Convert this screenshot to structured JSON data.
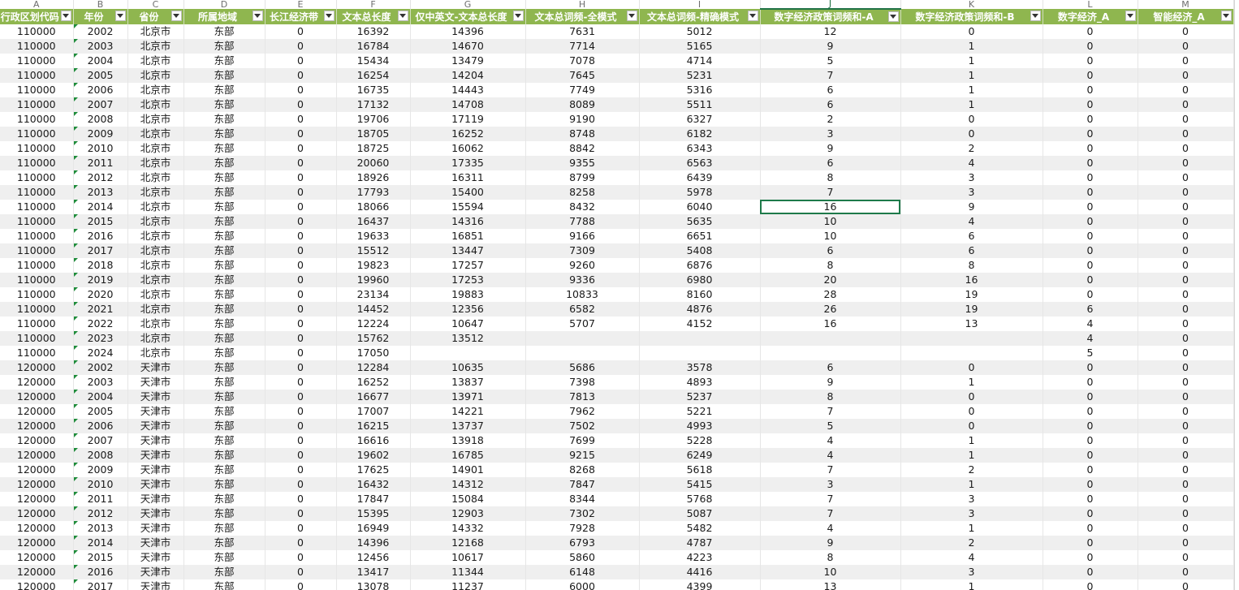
{
  "column_letters": [
    "A",
    "B",
    "C",
    "D",
    "E",
    "F",
    "G",
    "H",
    "I",
    "J",
    "K",
    "L",
    "M"
  ],
  "active_column": "J",
  "headers": [
    "行政区划代码",
    "年份",
    "省份",
    "所属地域",
    "长江经济带",
    "文本总长度",
    "仅中英文-文本总长度",
    "文本总词频-全模式",
    "文本总词频-精确模式",
    "数字经济政策词频和-A",
    "数字经济政策词频和-B",
    "数字经济_A",
    "智能经济_A"
  ],
  "rows": [
    [
      "110000",
      "2002",
      "北京市",
      "东部",
      "0",
      "16392",
      "14396",
      "7631",
      "5012",
      "12",
      "0",
      "0",
      "0"
    ],
    [
      "110000",
      "2003",
      "北京市",
      "东部",
      "0",
      "16784",
      "14670",
      "7714",
      "5165",
      "9",
      "1",
      "0",
      "0"
    ],
    [
      "110000",
      "2004",
      "北京市",
      "东部",
      "0",
      "15434",
      "13479",
      "7078",
      "4714",
      "5",
      "1",
      "0",
      "0"
    ],
    [
      "110000",
      "2005",
      "北京市",
      "东部",
      "0",
      "16254",
      "14204",
      "7645",
      "5231",
      "7",
      "1",
      "0",
      "0"
    ],
    [
      "110000",
      "2006",
      "北京市",
      "东部",
      "0",
      "16735",
      "14443",
      "7749",
      "5316",
      "6",
      "1",
      "0",
      "0"
    ],
    [
      "110000",
      "2007",
      "北京市",
      "东部",
      "0",
      "17132",
      "14708",
      "8089",
      "5511",
      "6",
      "1",
      "0",
      "0"
    ],
    [
      "110000",
      "2008",
      "北京市",
      "东部",
      "0",
      "19706",
      "17119",
      "9190",
      "6327",
      "2",
      "0",
      "0",
      "0"
    ],
    [
      "110000",
      "2009",
      "北京市",
      "东部",
      "0",
      "18705",
      "16252",
      "8748",
      "6182",
      "3",
      "0",
      "0",
      "0"
    ],
    [
      "110000",
      "2010",
      "北京市",
      "东部",
      "0",
      "18725",
      "16062",
      "8842",
      "6343",
      "9",
      "2",
      "0",
      "0"
    ],
    [
      "110000",
      "2011",
      "北京市",
      "东部",
      "0",
      "20060",
      "17335",
      "9355",
      "6563",
      "6",
      "4",
      "0",
      "0"
    ],
    [
      "110000",
      "2012",
      "北京市",
      "东部",
      "0",
      "18926",
      "16311",
      "8799",
      "6439",
      "8",
      "3",
      "0",
      "0"
    ],
    [
      "110000",
      "2013",
      "北京市",
      "东部",
      "0",
      "17793",
      "15400",
      "8258",
      "5978",
      "7",
      "3",
      "0",
      "0"
    ],
    [
      "110000",
      "2014",
      "北京市",
      "东部",
      "0",
      "18066",
      "15594",
      "8432",
      "6040",
      "16",
      "9",
      "0",
      "0"
    ],
    [
      "110000",
      "2015",
      "北京市",
      "东部",
      "0",
      "16437",
      "14316",
      "7788",
      "5635",
      "10",
      "4",
      "0",
      "0"
    ],
    [
      "110000",
      "2016",
      "北京市",
      "东部",
      "0",
      "19633",
      "16851",
      "9166",
      "6651",
      "10",
      "6",
      "0",
      "0"
    ],
    [
      "110000",
      "2017",
      "北京市",
      "东部",
      "0",
      "15512",
      "13447",
      "7309",
      "5408",
      "6",
      "6",
      "0",
      "0"
    ],
    [
      "110000",
      "2018",
      "北京市",
      "东部",
      "0",
      "19823",
      "17257",
      "9260",
      "6876",
      "8",
      "8",
      "0",
      "0"
    ],
    [
      "110000",
      "2019",
      "北京市",
      "东部",
      "0",
      "19960",
      "17253",
      "9336",
      "6980",
      "20",
      "16",
      "0",
      "0"
    ],
    [
      "110000",
      "2020",
      "北京市",
      "东部",
      "0",
      "23134",
      "19883",
      "10833",
      "8160",
      "28",
      "19",
      "0",
      "0"
    ],
    [
      "110000",
      "2021",
      "北京市",
      "东部",
      "0",
      "14452",
      "12356",
      "6582",
      "4876",
      "26",
      "19",
      "6",
      "0"
    ],
    [
      "110000",
      "2022",
      "北京市",
      "东部",
      "0",
      "12224",
      "10647",
      "5707",
      "4152",
      "16",
      "13",
      "4",
      "0"
    ],
    [
      "110000",
      "2023",
      "北京市",
      "东部",
      "0",
      "15762",
      "13512",
      "",
      "",
      "",
      "",
      "4",
      "0"
    ],
    [
      "110000",
      "2024",
      "北京市",
      "东部",
      "0",
      "17050",
      "",
      "",
      "",
      "",
      "",
      "5",
      "0"
    ],
    [
      "120000",
      "2002",
      "天津市",
      "东部",
      "0",
      "12284",
      "10635",
      "5686",
      "3578",
      "6",
      "0",
      "0",
      "0"
    ],
    [
      "120000",
      "2003",
      "天津市",
      "东部",
      "0",
      "16252",
      "13837",
      "7398",
      "4893",
      "9",
      "1",
      "0",
      "0"
    ],
    [
      "120000",
      "2004",
      "天津市",
      "东部",
      "0",
      "16677",
      "13971",
      "7813",
      "5237",
      "8",
      "0",
      "0",
      "0"
    ],
    [
      "120000",
      "2005",
      "天津市",
      "东部",
      "0",
      "17007",
      "14221",
      "7962",
      "5221",
      "7",
      "0",
      "0",
      "0"
    ],
    [
      "120000",
      "2006",
      "天津市",
      "东部",
      "0",
      "16215",
      "13737",
      "7502",
      "4993",
      "5",
      "0",
      "0",
      "0"
    ],
    [
      "120000",
      "2007",
      "天津市",
      "东部",
      "0",
      "16616",
      "13918",
      "7699",
      "5228",
      "4",
      "1",
      "0",
      "0"
    ],
    [
      "120000",
      "2008",
      "天津市",
      "东部",
      "0",
      "19602",
      "16785",
      "9215",
      "6249",
      "4",
      "1",
      "0",
      "0"
    ],
    [
      "120000",
      "2009",
      "天津市",
      "东部",
      "0",
      "17625",
      "14901",
      "8268",
      "5618",
      "7",
      "2",
      "0",
      "0"
    ],
    [
      "120000",
      "2010",
      "天津市",
      "东部",
      "0",
      "16432",
      "14312",
      "7847",
      "5415",
      "3",
      "1",
      "0",
      "0"
    ],
    [
      "120000",
      "2011",
      "天津市",
      "东部",
      "0",
      "17847",
      "15084",
      "8344",
      "5768",
      "7",
      "3",
      "0",
      "0"
    ],
    [
      "120000",
      "2012",
      "天津市",
      "东部",
      "0",
      "15395",
      "12903",
      "7302",
      "5087",
      "7",
      "3",
      "0",
      "0"
    ],
    [
      "120000",
      "2013",
      "天津市",
      "东部",
      "0",
      "16949",
      "14332",
      "7928",
      "5482",
      "4",
      "1",
      "0",
      "0"
    ],
    [
      "120000",
      "2014",
      "天津市",
      "东部",
      "0",
      "14396",
      "12168",
      "6793",
      "4787",
      "9",
      "2",
      "0",
      "0"
    ],
    [
      "120000",
      "2015",
      "天津市",
      "东部",
      "0",
      "12456",
      "10617",
      "5860",
      "4223",
      "8",
      "4",
      "0",
      "0"
    ],
    [
      "120000",
      "2016",
      "天津市",
      "东部",
      "0",
      "13417",
      "11344",
      "6148",
      "4416",
      "10",
      "3",
      "0",
      "0"
    ],
    [
      "120000",
      "2017",
      "天津市",
      "东部",
      "0",
      "13078",
      "11237",
      "6000",
      "4399",
      "13",
      "1",
      "0",
      "0"
    ]
  ],
  "selected_cell": {
    "row": 12,
    "col": 9
  },
  "colors": {
    "header_bg": "#8fb64f",
    "header_text": "#ffffff",
    "stripe": "#efefef",
    "selection": "#1e7a4a",
    "text_marker": "#1e8c3a"
  }
}
